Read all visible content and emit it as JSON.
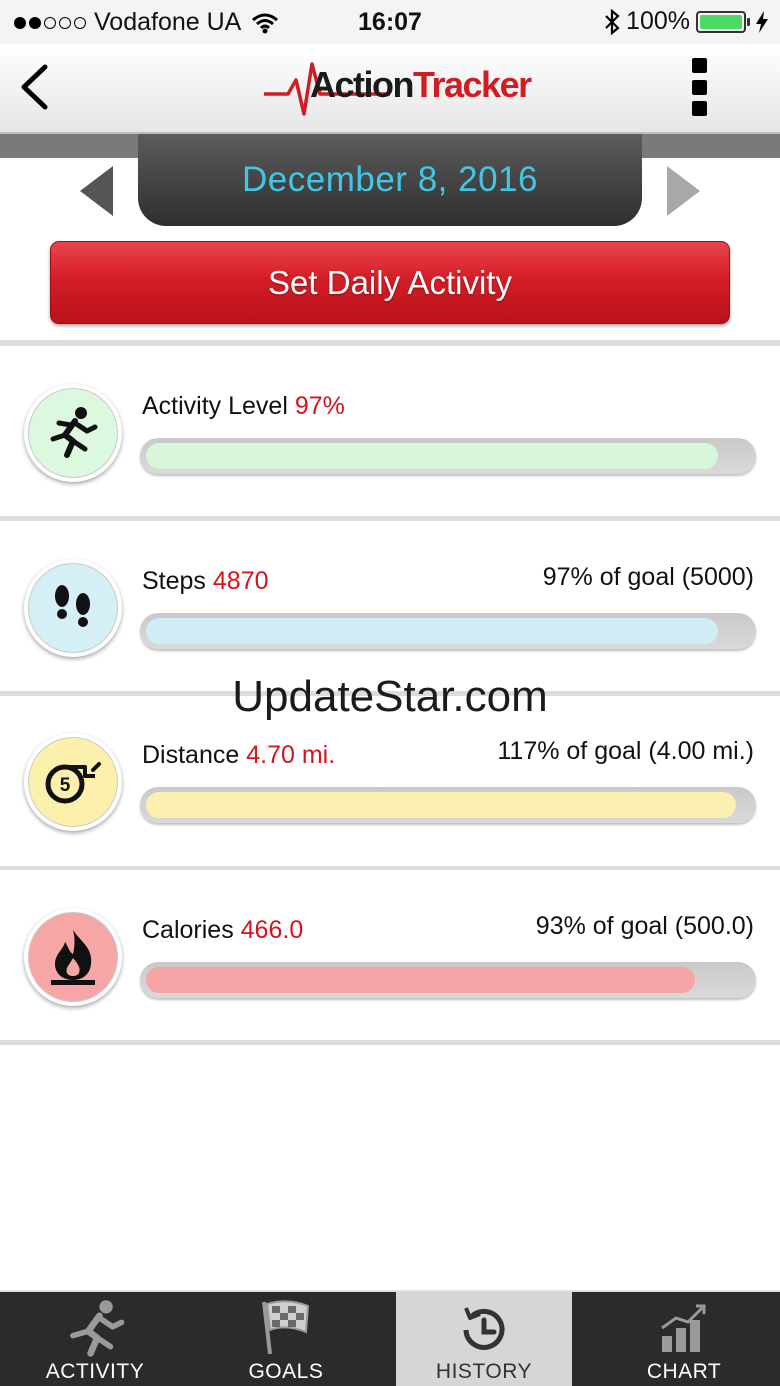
{
  "status_bar": {
    "carrier": "Vodafone UA",
    "time": "16:07",
    "battery": "100%",
    "icons": [
      "signal-dots-icon",
      "wifi-icon",
      "bluetooth-icon",
      "battery-icon",
      "charging-bolt-icon"
    ]
  },
  "header": {
    "logo_action": "Action",
    "logo_tracker": "Tracker",
    "back_icon": "chevron-left-icon",
    "menu_icon": "vertical-menu-icon"
  },
  "date_nav": {
    "date": "December 8, 2016",
    "prev_icon": "triangle-left-icon",
    "next_icon": "triangle-right-icon"
  },
  "set_button": {
    "label": "Set Daily Activity"
  },
  "metrics": [
    {
      "label": "Activity Level",
      "value": "97%",
      "goal": "",
      "progress": 0.97,
      "icon": "running-person-icon",
      "circle_color": "#dcf8df",
      "fill_color": "#d8f7da"
    },
    {
      "label": "Steps",
      "value": "4870",
      "goal": "97% of goal (5000)",
      "progress": 0.97,
      "icon": "footprints-icon",
      "circle_color": "#d5eff6",
      "fill_color": "#d0edf5"
    },
    {
      "label": "Distance",
      "value": "4.70 mi.",
      "goal": "117% of goal (4.00 mi.)",
      "progress": 1.0,
      "icon": "tape-measure-icon",
      "circle_color": "#fbf1ad",
      "fill_color": "#fbf0b2"
    },
    {
      "label": "Calories",
      "value": "466.0",
      "goal": "93% of goal (500.0)",
      "progress": 0.93,
      "icon": "flame-icon",
      "circle_color": "#f7a6a6",
      "fill_color": "#f6a4a5"
    }
  ],
  "watermark": "UpdateStar.com",
  "tabs": [
    {
      "label": "ACTIVITY",
      "icon": "running-person-icon",
      "active": false
    },
    {
      "label": "GOALS",
      "icon": "checkered-flag-icon",
      "active": false
    },
    {
      "label": "HISTORY",
      "icon": "history-clock-icon",
      "active": true
    },
    {
      "label": "CHART",
      "icon": "bar-chart-icon",
      "active": false
    }
  ],
  "colors": {
    "accent_red": "#d4141c",
    "date_cyan": "#42c6e6",
    "tabbar_bg": "#2b2b2b"
  }
}
